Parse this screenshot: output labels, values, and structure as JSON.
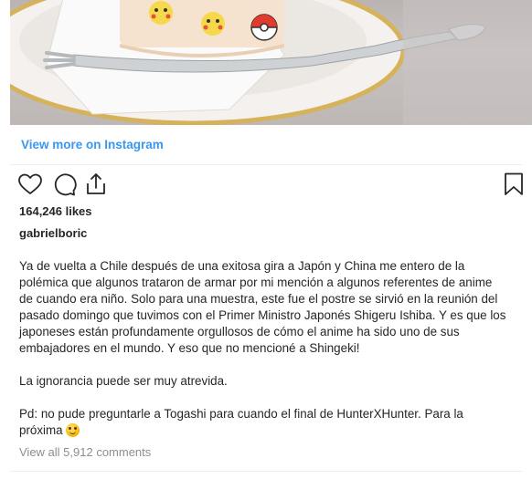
{
  "post": {
    "view_more_label": "View more on Instagram",
    "likes": "164,246 likes",
    "username": "gabrielboric",
    "caption_paragraphs": [
      "Ya de vuelta a Chile después de una exitosa gira a Japón y China me entero de la\npolémica que algunos trataron de armar por mi mención a algunos referentes de anime\nde cuando era niño. Solo para una muestra, este fue el postre se sirvió en la reunión del\npasado domingo que tuvimos con el Primer Ministro Japonés Shigeru Ishiba. Y es que los\njaponeses están profundamente orgullosos de cómo el anime ha sido uno de sus\nembajadores en el mundo. Y eso que no mencioné a Shingeki!",
      "La ignorancia puede ser muy atrevida.",
      "Pd: no pude preguntarle a Togashi para cuando el final de HunterXHunter. Para la\npróxima"
    ],
    "view_all_comments": "View all 5,912 comments"
  },
  "icons": {
    "like": "heart-icon",
    "comment": "comment-bubble-icon",
    "share": "share-upload-icon",
    "save": "bookmark-icon",
    "caption_emoji": "smiling-face-emoji"
  },
  "colors": {
    "link": "#3897f0",
    "text": "#262626",
    "muted": "#8e8e8e"
  }
}
